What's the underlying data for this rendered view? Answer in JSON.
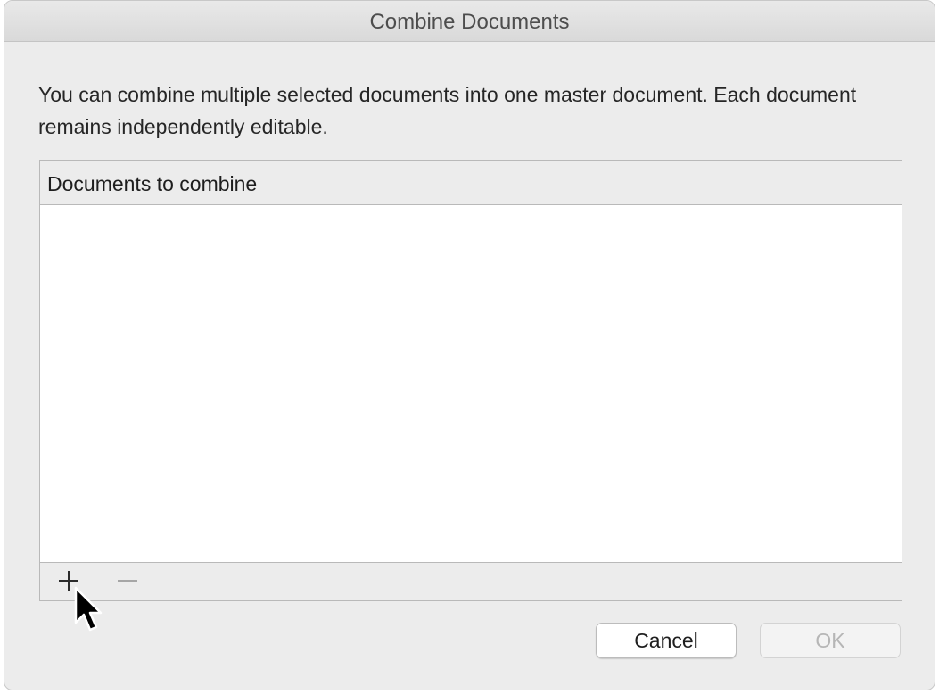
{
  "window": {
    "title": "Combine Documents"
  },
  "description": "You can combine multiple selected documents into one master document. Each document remains independently editable.",
  "document_list": {
    "header": "Documents to combine",
    "items": [],
    "add_icon": "plus-icon",
    "remove_icon": "minus-icon"
  },
  "buttons": {
    "cancel_label": "Cancel",
    "ok_label": "OK",
    "ok_enabled": false
  },
  "cursor": {
    "icon": "arrow-cursor-icon"
  },
  "colors": {
    "window_background": "#ececec",
    "list_background": "#ffffff",
    "disabled_text": "#b6b6b6"
  }
}
